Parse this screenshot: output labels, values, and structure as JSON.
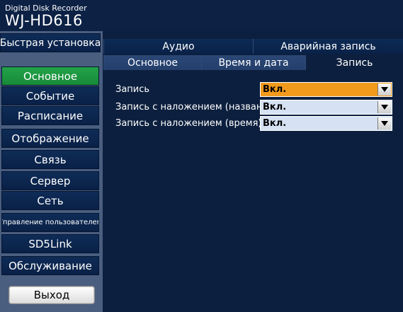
{
  "device": {
    "title_small": "Digital Disk Recorder",
    "model": "WJ-HD616"
  },
  "sidebar": {
    "quick_setup": "Быстрая установка",
    "items": [
      {
        "label": "Основное",
        "active": true
      },
      {
        "label": "Событие",
        "active": false
      },
      {
        "label": "Расписание",
        "active": false
      },
      {
        "label": "Отображение",
        "active": false
      },
      {
        "label": "Связь",
        "active": false
      },
      {
        "label": "Сервер",
        "active": false
      },
      {
        "label": "Сеть",
        "active": false
      },
      {
        "label": "Управление пользователем",
        "active": false
      },
      {
        "label": "SD5Link",
        "active": false
      },
      {
        "label": "Обслуживание",
        "active": false
      }
    ],
    "exit": "Выход"
  },
  "tabs": {
    "row1": [
      "Аудио",
      "Аварийная запись"
    ],
    "row2": [
      "Основное",
      "Время и дата",
      "Запись"
    ],
    "selected": "Запись"
  },
  "settings": [
    {
      "label": "Запись",
      "value": "Вкл.",
      "focused": true
    },
    {
      "label": "Запись с наложением (название)",
      "value": "Вкл.",
      "focused": false
    },
    {
      "label": "Запись с наложением (время)",
      "value": "Вкл.",
      "focused": false
    }
  ],
  "colors": {
    "background": "#0c1f3e",
    "active_menu": "#23a34a",
    "focused_field": "#f19a1c",
    "field": "#d6e2f3"
  }
}
